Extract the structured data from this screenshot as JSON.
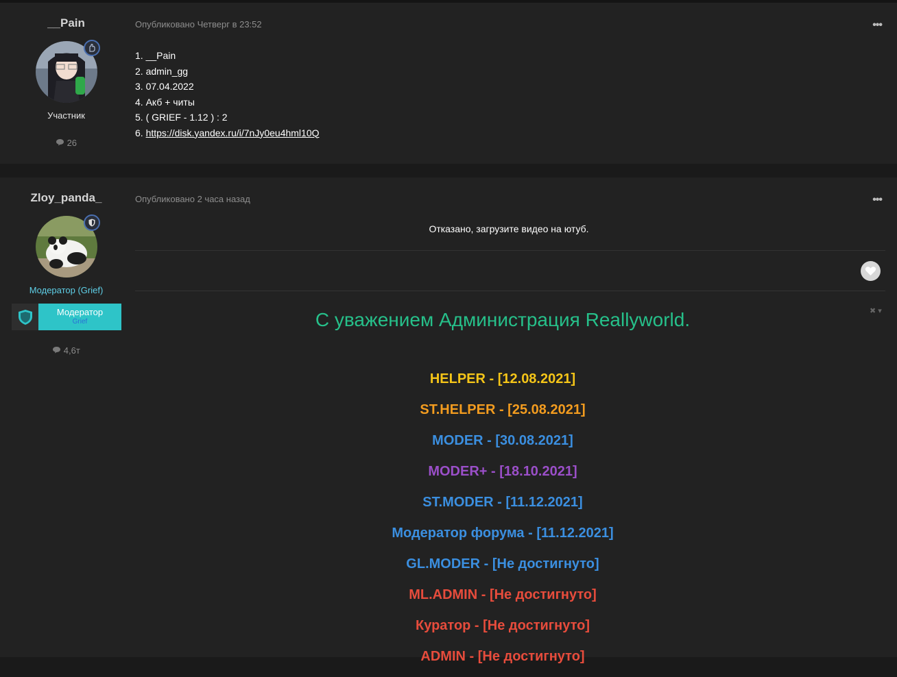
{
  "posts": [
    {
      "author": "__Pain",
      "role": "Участник",
      "post_count": "26",
      "meta": "Опубликовано Четверг в 23:52",
      "menu": "•••",
      "lines": [
        "1. __Pain",
        "2. admin_gg",
        "3. 07.04.2022",
        "4. Акб + читы",
        "5. ( GRIEF - 1.12 ) : 2"
      ],
      "link_prefix": "6. ",
      "link": "https://disk.yandex.ru/i/7nJy0eu4hml10Q"
    },
    {
      "author": "Zloy_panda_",
      "role": "Модератор (Grief)",
      "group_label": "Модератор",
      "group_sub": "Grief",
      "post_count": "4,6т",
      "meta": "Опубликовано 2 часа назад",
      "menu": "•••",
      "text": "Отказано, загрузите видео на ютуб.",
      "signature": {
        "title": "С уважением Администрация Reallyworld.",
        "lines": [
          {
            "text": "HELPER - [12.08.2021]",
            "color": "#f5c518"
          },
          {
            "text": "ST.HELPER - [25.08.2021]",
            "color": "#f39c1f"
          },
          {
            "text": "MODER - [30.08.2021]",
            "color": "#3b8fe0"
          },
          {
            "text": "MODER+ - [18.10.2021]",
            "color": "#9b4fc9"
          },
          {
            "text": "ST.MODER - [11.12.2021]",
            "color": "#3b8fe0"
          },
          {
            "text": "Модератор форума - [11.12.2021]",
            "color": "#3b8fe0"
          },
          {
            "text": "GL.MODER - [Не достигнуто]",
            "color": "#3b8fe0"
          },
          {
            "text": "ML.ADMIN - [Не достигнуто]",
            "color": "#e74c3c"
          },
          {
            "text": "Куратор - [Не достигнуто]",
            "color": "#e74c3c"
          },
          {
            "text": "ADMIN - [Не достигнуто]",
            "color": "#e74c3c"
          }
        ]
      }
    }
  ],
  "icons": {
    "comment": "comment-icon",
    "member_badge": "hand-icon",
    "mod_badge": "shield-icon",
    "like": "heart-icon"
  }
}
